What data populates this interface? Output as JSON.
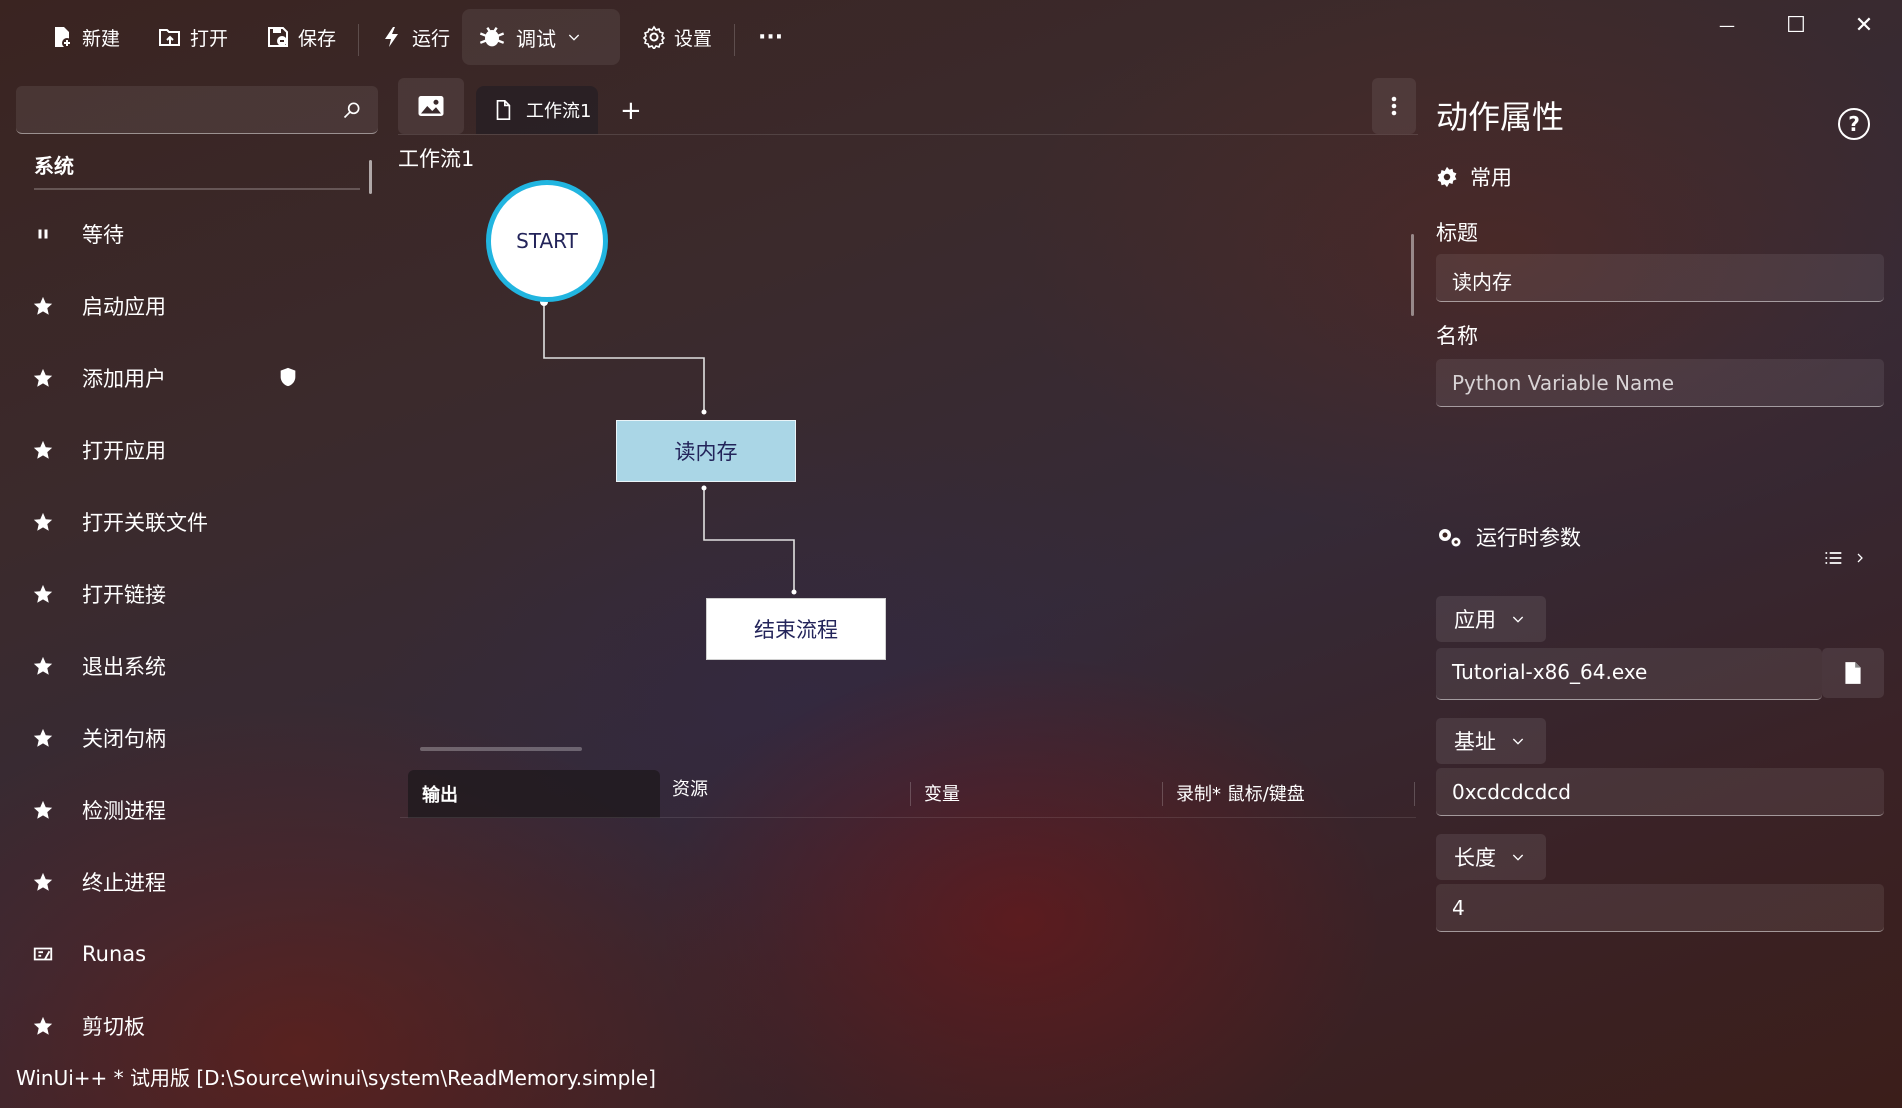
{
  "toolbar": {
    "new_label": "新建",
    "open_label": "打开",
    "save_label": "保存",
    "run_label": "运行",
    "debug_label": "调试",
    "settings_label": "设置",
    "more_label": "···"
  },
  "window_controls": {
    "minimize": "—",
    "maximize": "☐",
    "close": "✕"
  },
  "left_panel": {
    "search_placeholder": "",
    "category": "系统",
    "actions": [
      {
        "label": "等待",
        "icon": "pause-icon"
      },
      {
        "label": "启动应用",
        "icon": "star-icon"
      },
      {
        "label": "添加用户",
        "icon": "star-icon",
        "badge": "shield-icon"
      },
      {
        "label": "打开应用",
        "icon": "star-icon"
      },
      {
        "label": "打开关联文件",
        "icon": "star-icon"
      },
      {
        "label": "打开链接",
        "icon": "star-icon"
      },
      {
        "label": "退出系统",
        "icon": "star-icon"
      },
      {
        "label": "关闭句柄",
        "icon": "star-icon"
      },
      {
        "label": "检测进程",
        "icon": "star-icon"
      },
      {
        "label": "终止进程",
        "icon": "star-icon"
      },
      {
        "label": "Runas",
        "icon": "runas-icon"
      },
      {
        "label": "剪切板",
        "icon": "star-icon"
      }
    ]
  },
  "status_bar": {
    "text": "WinUi++ * 试用版 [D:\\Source\\winui\\system\\ReadMemory.simple]"
  },
  "editor": {
    "tab_title": "工作流1",
    "add_tab": "+",
    "workflow_label": "工作流1",
    "nodes": {
      "start": "START",
      "read": "读内存",
      "end": "结束流程"
    },
    "bottom_tabs": [
      "输出",
      "资源",
      "变量",
      "录制* 鼠标/键盘"
    ]
  },
  "properties": {
    "title": "动作属性",
    "help": "?",
    "common_section": "常用",
    "title_label": "标题",
    "title_value": "读内存",
    "name_label": "名称",
    "name_placeholder": "Python Variable Name",
    "runtime_section": "运行时参数",
    "app_combo": "应用",
    "app_value": "Tutorial-x86_64.exe",
    "base_combo": "基址",
    "base_value": "0xcdcdcdcd",
    "length_combo": "长度",
    "length_value": "4"
  },
  "colors": {
    "start_border": "#21b5e0",
    "read_node_fill": "#aad6e6",
    "node_text": "#23245a"
  }
}
